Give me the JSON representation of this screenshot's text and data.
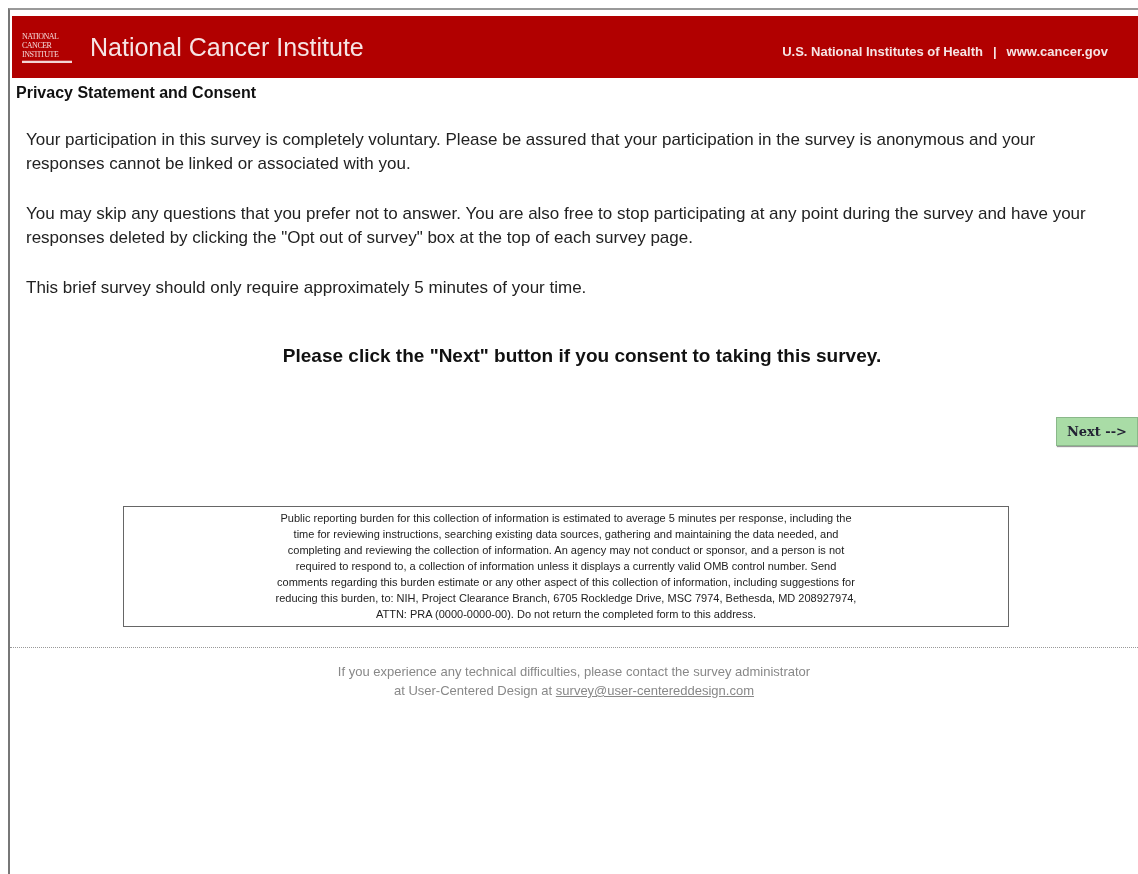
{
  "header": {
    "logo_lines": [
      "NATIONAL",
      "CANCER",
      "INSTITUTE"
    ],
    "title": "National Cancer Institute",
    "links": [
      "U.S. National Institutes of Health",
      "www.cancer.gov"
    ],
    "separator": "|"
  },
  "page_title": "Privacy Statement and Consent",
  "paragraphs": [
    "Your participation in this survey is completely voluntary. Please be assured that your participation in the survey is anonymous and your responses cannot be linked or associated with you.",
    "You may skip any questions that you prefer not to answer. You are also free to stop participating at any point during the survey and have your responses deleted by clicking the \"Opt out of survey\" box at the top of each survey page.",
    "This brief survey should only require approximately 5 minutes of your time."
  ],
  "consent": "Please click the \"Next\" button if you consent to taking this survey.",
  "next_button": "Next -->",
  "burden_statement": [
    "Public reporting burden for this collection of information is estimated to average 5 minutes per response, including the",
    "time for reviewing instructions, searching existing data sources, gathering and maintaining the data needed, and",
    "completing and reviewing the collection of information. An agency may not conduct or sponsor, and a person is not",
    "required to respond to, a collection of information unless it displays a currently valid OMB control number. Send",
    "comments regarding this burden estimate or any other aspect of this collection of information, including suggestions for",
    "reducing this burden, to: NIH, Project Clearance Branch, 6705 Rockledge Drive, MSC 7974, Bethesda, MD 208927974,",
    "ATTN: PRA (0000-0000-00). Do not return the completed form to this address."
  ],
  "footer": {
    "lines": [
      "If you experience any technical difficulties, please contact the survey administrator",
      "at User-Centered Design at"
    ],
    "link": "survey@user-centereddesign.com"
  }
}
